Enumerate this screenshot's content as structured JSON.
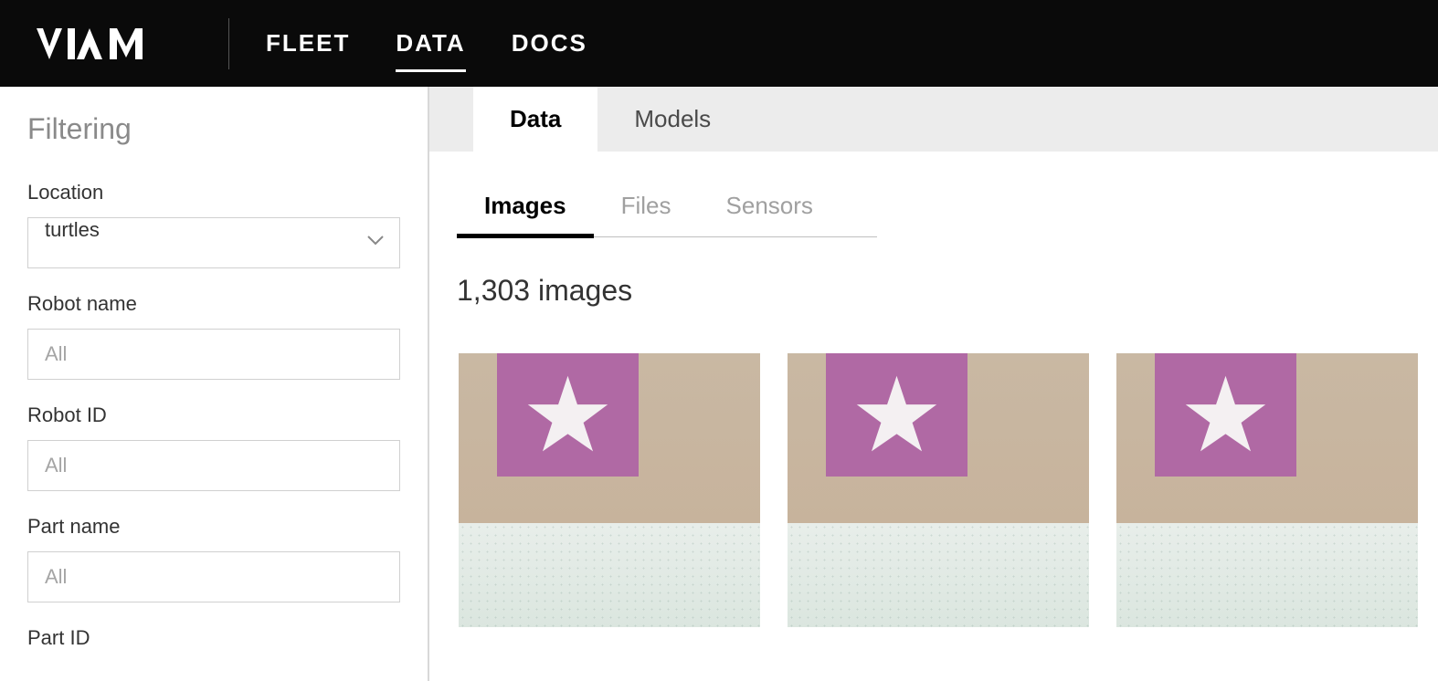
{
  "nav": {
    "items": [
      {
        "label": "FLEET",
        "active": false
      },
      {
        "label": "DATA",
        "active": true
      },
      {
        "label": "DOCS",
        "active": false
      }
    ]
  },
  "sidebar": {
    "title": "Filtering",
    "fields": {
      "location": {
        "label": "Location",
        "value": "turtles"
      },
      "robot_name": {
        "label": "Robot name",
        "placeholder": "All"
      },
      "robot_id": {
        "label": "Robot ID",
        "placeholder": "All"
      },
      "part_name": {
        "label": "Part name",
        "placeholder": "All"
      },
      "part_id": {
        "label": "Part ID"
      }
    }
  },
  "main": {
    "tabs": [
      {
        "label": "Data",
        "active": true
      },
      {
        "label": "Models",
        "active": false
      }
    ],
    "subtabs": [
      {
        "label": "Images",
        "active": true
      },
      {
        "label": "Files",
        "active": false
      },
      {
        "label": "Sensors",
        "active": false
      }
    ],
    "count_text": "1,303 images",
    "thumbnails": [
      {
        "name": "image-thumbnail-1"
      },
      {
        "name": "image-thumbnail-2"
      },
      {
        "name": "image-thumbnail-3"
      }
    ]
  }
}
